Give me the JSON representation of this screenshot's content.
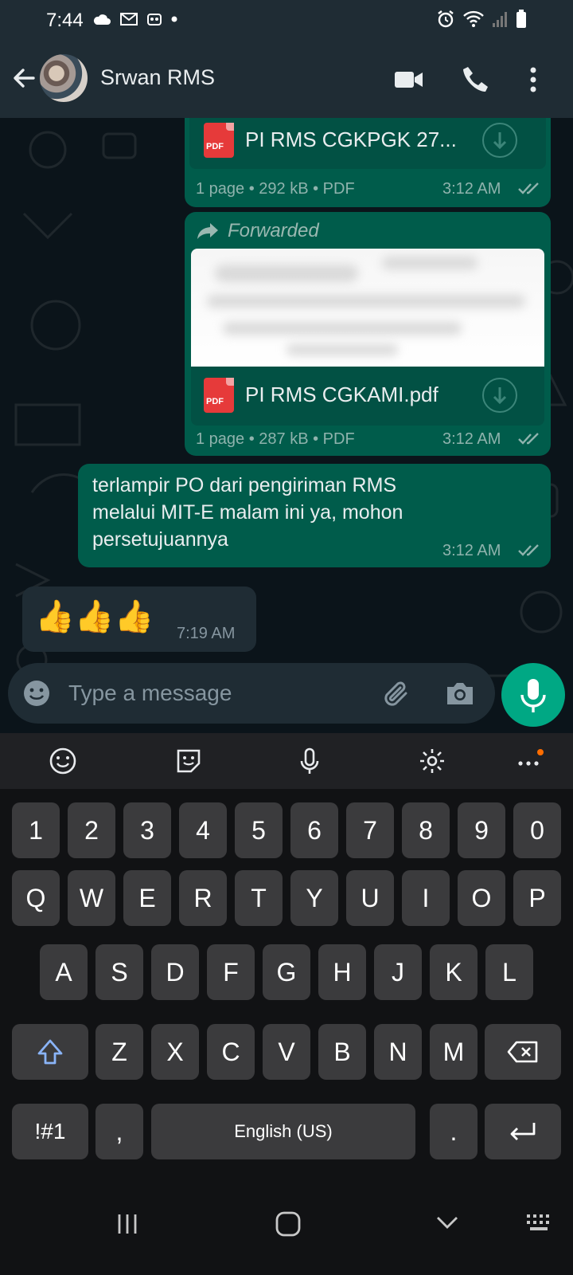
{
  "status_bar": {
    "time": "7:44"
  },
  "header": {
    "contact_name": "Srwan RMS"
  },
  "messages": [
    {
      "type": "document",
      "file_name": "PI RMS CGKPGK 27...",
      "meta": "1 page • 292 kB • PDF",
      "time": "3:12 AM",
      "file_badge": "PDF"
    },
    {
      "type": "document",
      "forwarded_label": "Forwarded",
      "file_name": "PI RMS CGKAMI.pdf",
      "meta": "1 page • 287 kB • PDF",
      "time": "3:12 AM",
      "file_badge": "PDF"
    },
    {
      "type": "text",
      "lines": [
        "terlampir PO dari pengiriman RMS",
        "melalui MIT-E malam ini ya, mohon",
        "persetujuannya"
      ],
      "time": "3:12 AM"
    },
    {
      "type": "incoming",
      "text": "👍👍👍",
      "time": "7:19 AM"
    }
  ],
  "composer": {
    "placeholder": "Type a message"
  },
  "keyboard": {
    "row_numbers": [
      "1",
      "2",
      "3",
      "4",
      "5",
      "6",
      "7",
      "8",
      "9",
      "0"
    ],
    "row_top": [
      "Q",
      "W",
      "E",
      "R",
      "T",
      "Y",
      "U",
      "I",
      "O",
      "P"
    ],
    "row_mid": [
      "A",
      "S",
      "D",
      "F",
      "G",
      "H",
      "J",
      "K",
      "L"
    ],
    "row_bottom": [
      "Z",
      "X",
      "C",
      "V",
      "B",
      "N",
      "M"
    ],
    "symbols_key": "!#1",
    "comma_key": ",",
    "space_label": "English (US)",
    "period_key": "."
  },
  "colors": {
    "accent": "#00a884",
    "bubble_out": "#005c4b",
    "bubble_in": "#1f2c34",
    "tick_read": "#8fb3ad"
  }
}
